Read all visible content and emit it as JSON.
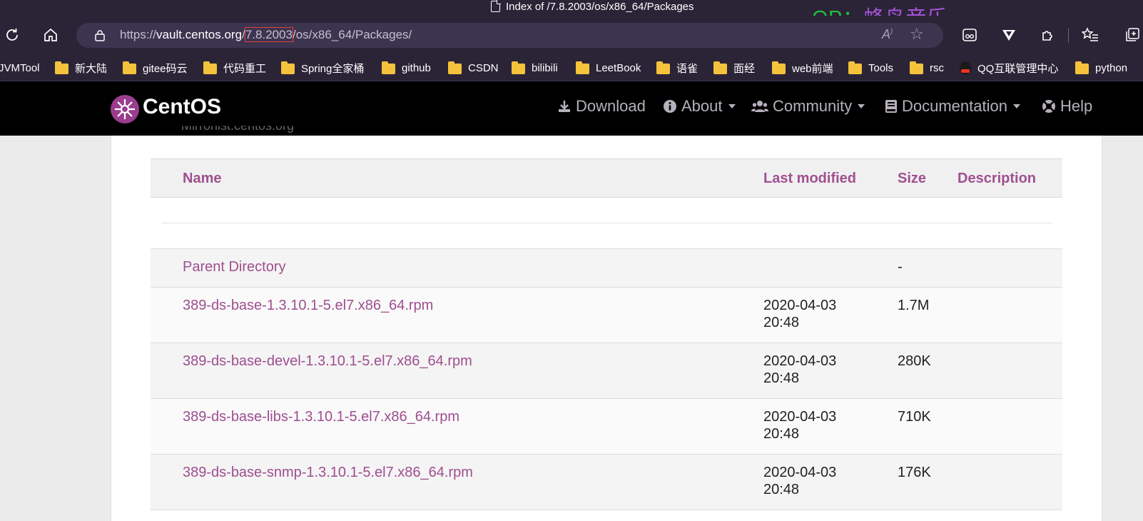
{
  "browser": {
    "tab_title": "Index of /7.8.2003/os/x86_64/Packages",
    "watermark_latin": "OP：",
    "watermark_zh": "蜂鸟音乐",
    "url_scheme": "https://",
    "url_host": "vault.centos.org",
    "url_slash": "/",
    "url_highlight": "7.8.2003",
    "url_path": "/os/x86_64/Packages/",
    "bookmarks": [
      "JVMTool",
      "新大陆",
      "gitee码云",
      "代码重工",
      "Spring全家桶",
      "github",
      "CSDN",
      "bilibili",
      "LeetBook",
      "语雀",
      "面经",
      "web前端",
      "Tools",
      "rsc",
      "QQ互联管理中心",
      "python"
    ]
  },
  "navbar": {
    "brand": "CentOS",
    "items": [
      "Download",
      "About",
      "Community",
      "Documentation",
      "Help"
    ]
  },
  "partial_text": "Mirrorlist.centos.org",
  "table": {
    "headers": {
      "name": "Name",
      "modified": "Last modified",
      "size": "Size",
      "description": "Description"
    },
    "rows": [
      {
        "name": "Parent Directory",
        "modified": "",
        "size": "-",
        "description": ""
      },
      {
        "name": "389-ds-base-1.3.10.1-5.el7.x86_64.rpm",
        "modified": "2020-04-03 20:48",
        "size": "1.7M",
        "description": ""
      },
      {
        "name": "389-ds-base-devel-1.3.10.1-5.el7.x86_64.rpm",
        "modified": "2020-04-03 20:48",
        "size": "280K",
        "description": ""
      },
      {
        "name": "389-ds-base-libs-1.3.10.1-5.el7.x86_64.rpm",
        "modified": "2020-04-03 20:48",
        "size": "710K",
        "description": ""
      },
      {
        "name": "389-ds-base-snmp-1.3.10.1-5.el7.x86_64.rpm",
        "modified": "2020-04-03 20:48",
        "size": "176K",
        "description": ""
      }
    ]
  },
  "colors": {
    "chrome": "#2b2437",
    "link": "#9e4e8f",
    "brand_purple": "#9b3d8e",
    "url_highlight_border": "#e0403a"
  }
}
